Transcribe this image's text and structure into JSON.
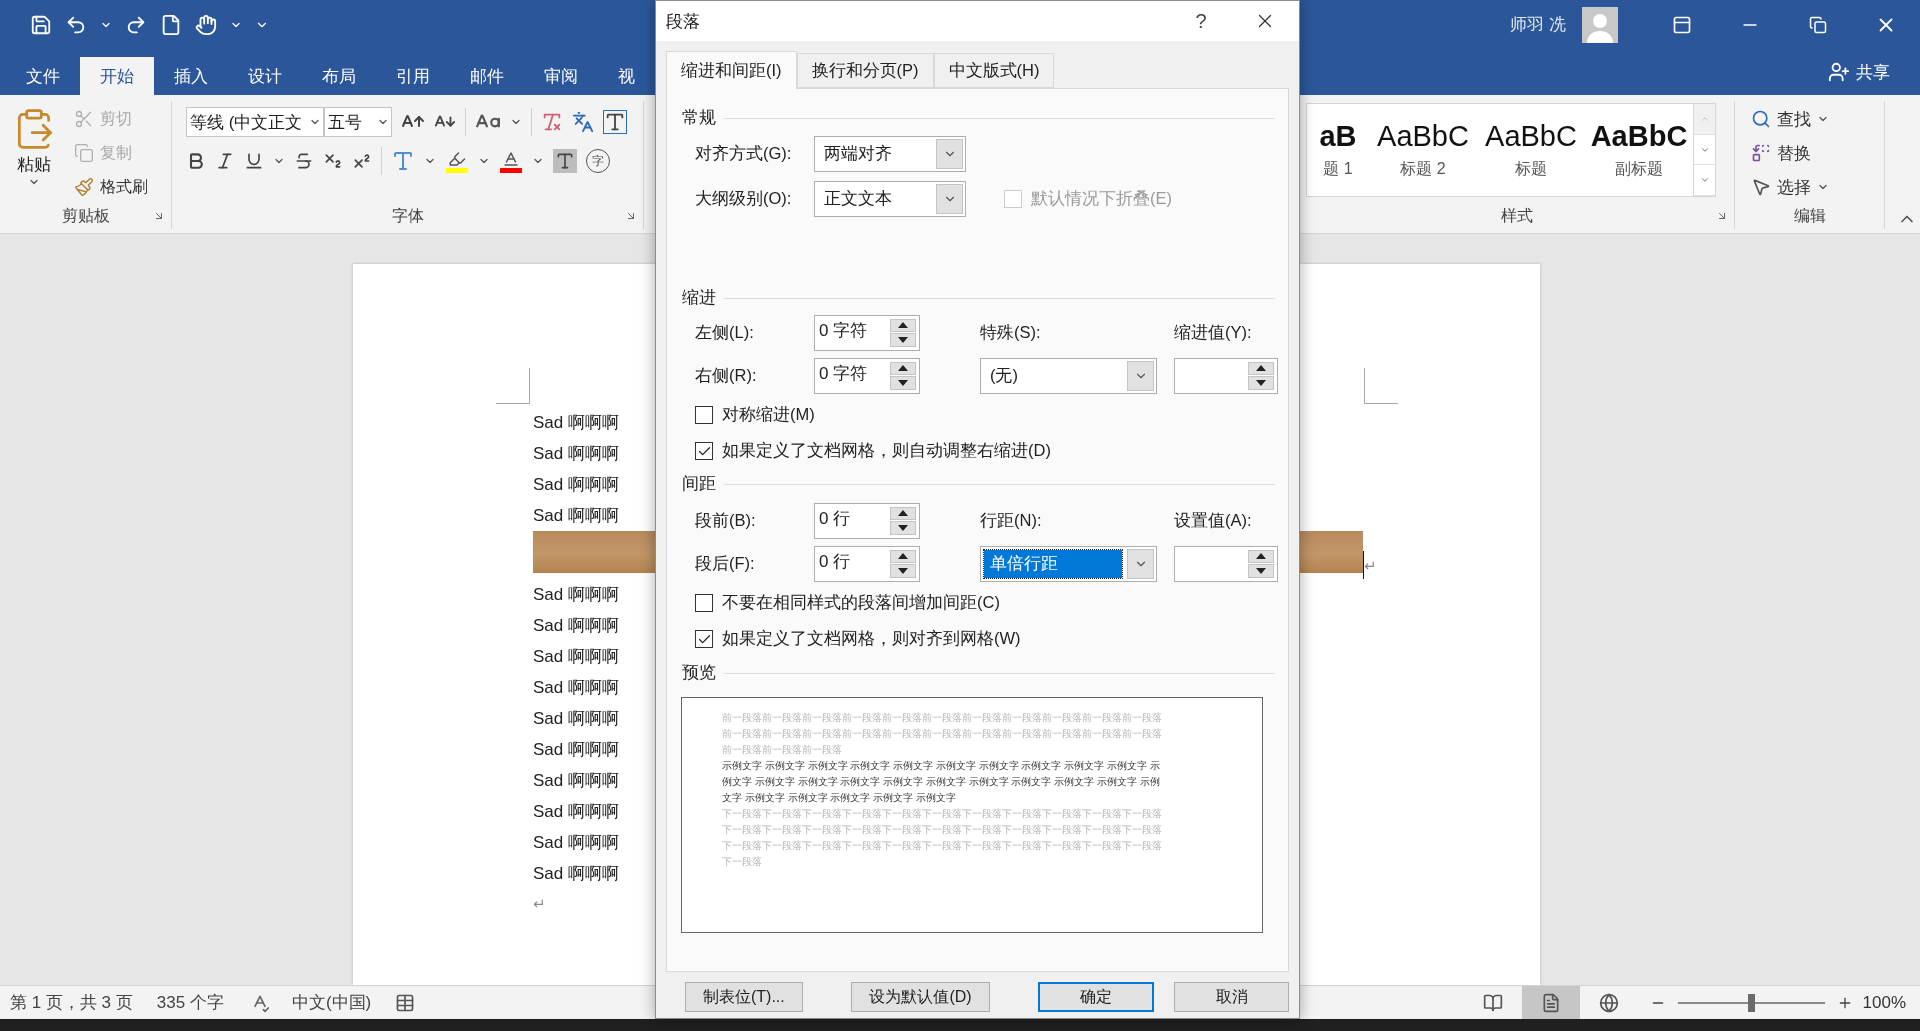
{
  "window": {
    "user": "师羽 冼",
    "share": "共享"
  },
  "ribbon_tabs": [
    {
      "label": "文件",
      "selected": false
    },
    {
      "label": "开始",
      "selected": true
    },
    {
      "label": "插入",
      "selected": false
    },
    {
      "label": "设计",
      "selected": false
    },
    {
      "label": "布局",
      "selected": false
    },
    {
      "label": "引用",
      "selected": false
    },
    {
      "label": "邮件",
      "selected": false
    },
    {
      "label": "审阅",
      "selected": false
    },
    {
      "label": "视",
      "selected": false
    }
  ],
  "clipboard": {
    "paste": "粘贴",
    "label": "剪贴板",
    "items": [
      {
        "kind": "cut",
        "label": "剪切",
        "disabled": true
      },
      {
        "kind": "copy",
        "label": "复制",
        "disabled": true
      },
      {
        "kind": "painter",
        "label": "格式刷",
        "disabled": false
      }
    ]
  },
  "font": {
    "name": "等线 (中文正文",
    "size": "五号",
    "enclose": "字",
    "label": "字体"
  },
  "styles": {
    "label": "样式",
    "items": [
      {
        "preview": "aB",
        "name": "题 1",
        "bold": true
      },
      {
        "preview": "AaBbC",
        "name": "标题 2",
        "bold": false
      },
      {
        "preview": "AaBbC",
        "name": "标题",
        "bold": false
      },
      {
        "preview": "AaBbC",
        "name": "副标题",
        "bold": true
      }
    ]
  },
  "editing": {
    "label": "编辑",
    "items": [
      {
        "kind": "find",
        "label": "查找"
      },
      {
        "kind": "replace",
        "label": "替换"
      },
      {
        "kind": "select",
        "label": "选择"
      }
    ]
  },
  "document": {
    "paragraphs": [
      {
        "kind": "text",
        "text": "Sad 啊啊啊"
      },
      {
        "kind": "text",
        "text": "Sad 啊啊啊"
      },
      {
        "kind": "text",
        "text": "Sad 啊啊啊"
      },
      {
        "kind": "text",
        "text": "Sad 啊啊啊"
      },
      {
        "kind": "image",
        "mark": "↵"
      },
      {
        "kind": "text",
        "text": "Sad 啊啊啊"
      },
      {
        "kind": "text",
        "text": "Sad 啊啊啊"
      },
      {
        "kind": "text",
        "text": "Sad 啊啊啊"
      },
      {
        "kind": "text",
        "text": "Sad 啊啊啊"
      },
      {
        "kind": "text",
        "text": "Sad 啊啊啊"
      },
      {
        "kind": "text",
        "text": "Sad 啊啊啊"
      },
      {
        "kind": "text",
        "text": "Sad 啊啊啊"
      },
      {
        "kind": "text",
        "text": "Sad 啊啊啊"
      },
      {
        "kind": "text",
        "text": "Sad 啊啊啊"
      },
      {
        "kind": "text",
        "text": "Sad 啊啊啊"
      },
      {
        "kind": "mark",
        "text": "↵"
      }
    ]
  },
  "status_bar": {
    "page": "第 1 页，共 3 页",
    "words": "335 个字",
    "language": "中文(中国)",
    "views": [
      {
        "kind": "read",
        "selected": false
      },
      {
        "kind": "print",
        "selected": true
      },
      {
        "kind": "web",
        "selected": false
      }
    ],
    "zoom": {
      "level": 0.5,
      "reading": "100%"
    }
  },
  "dialog": {
    "title": "段落",
    "help": "?",
    "tabs": [
      {
        "label": "缩进和间距(I)",
        "selected": true
      },
      {
        "label": "换行和分页(P)",
        "selected": false
      },
      {
        "label": "中文版式(H)",
        "selected": false
      }
    ],
    "general": {
      "heading": "常规",
      "alignment": {
        "label": "对齐方式(G):",
        "value": "两端对齐"
      },
      "outline": {
        "label": "大纲级别(O):",
        "value": "正文文本"
      },
      "collapse": {
        "label": "默认情况下折叠(E)",
        "checked": false,
        "disabled": true
      }
    },
    "indent": {
      "heading": "缩进",
      "left": {
        "label": "左侧(L):",
        "value": "0 字符"
      },
      "right": {
        "label": "右侧(R):",
        "value": "0 字符"
      },
      "special": {
        "label": "特殊(S):",
        "value": "(无)"
      },
      "by": {
        "label": "缩进值(Y):"
      },
      "checkboxes": [
        {
          "label": "对称缩进(M)",
          "checked": false
        },
        {
          "label": "如果定义了文档网格，则自动调整右缩进(D)",
          "checked": true
        }
      ]
    },
    "spacing": {
      "heading": "间距",
      "before": {
        "label": "段前(B):",
        "value": "0 行"
      },
      "after": {
        "label": "段后(F):",
        "value": "0 行"
      },
      "line": {
        "label": "行距(N):",
        "value": "单倍行距",
        "focused": true
      },
      "at": {
        "label": "设置值(A):"
      },
      "checkboxes": [
        {
          "label": "不要在相同样式的段落间增加间距(C)",
          "checked": false
        },
        {
          "label": "如果定义了文档网格，则对齐到网格(W)",
          "checked": true
        }
      ]
    },
    "preview": {
      "heading": "预览",
      "previous": "前一段落前一段落前一段落前一段落前一段落前一段落前一段落前一段落前一段落前一段落前一段落前一段落前一段落前一段落前一段落前一段落前一段落前一段落前一段落前一段落前一段落前一段落前一段落前一段落前一段落",
      "sample": "示例文字 示例文字 示例文字 示例文字 示例文字 示例文字 示例文字 示例文字 示例文字 示例文字 示例文字 示例文字 示例文字 示例文字 示例文字 示例文字 示例文字 示例文字 示例文字 示例文字 示例文字 示例文字 示例文字 示例文字 示例文字 示例文字",
      "next": "下一段落下一段落下一段落下一段落下一段落下一段落下一段落下一段落下一段落下一段落下一段落下一段落下一段落下一段落下一段落下一段落下一段落下一段落下一段落下一段落下一段落下一段落下一段落下一段落下一段落下一段落下一段落下一段落下一段落下一段落下一段落下一段落下一段落下一段落"
    },
    "buttons": [
      {
        "label": "制表位(T)...",
        "default": false
      },
      {
        "label": "设为默认值(D)",
        "default": false
      },
      {
        "label": "确定",
        "default": true
      },
      {
        "label": "取消",
        "default": false
      }
    ]
  }
}
